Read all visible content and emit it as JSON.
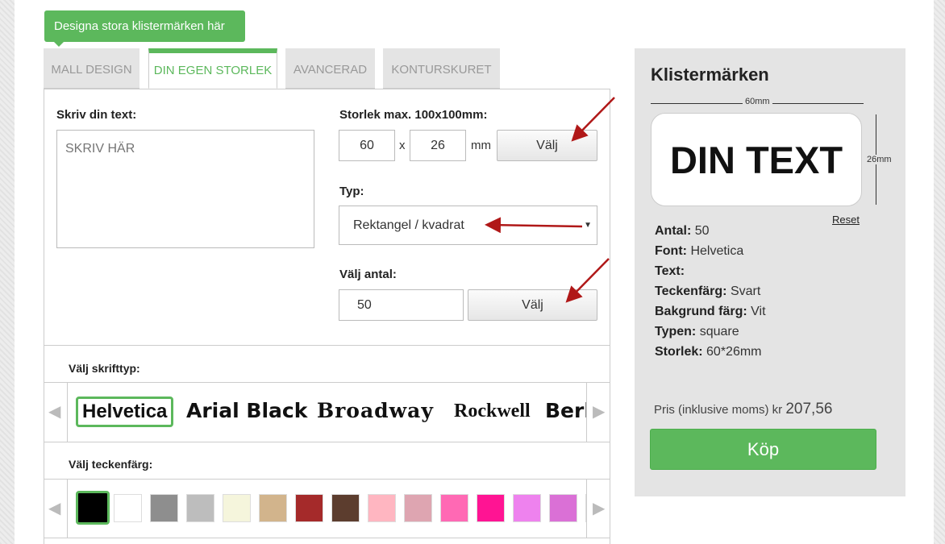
{
  "banner": "Designa stora klistermärken här",
  "tabs": [
    {
      "label": "MALL DESIGN",
      "active": false
    },
    {
      "label": "DIN EGEN STORLEK",
      "active": true
    },
    {
      "label": "AVANCERAD",
      "active": false
    },
    {
      "label": "KONTURSKURET",
      "active": false
    }
  ],
  "text_section": {
    "label": "Skriv din text:",
    "placeholder": "SKRIV HÄR"
  },
  "size_section": {
    "label": "Storlek max. 100x100mm:",
    "width": "60",
    "separator": "x",
    "height": "26",
    "unit": "mm",
    "button": "Välj"
  },
  "type_section": {
    "label": "Typ:",
    "selected": "Rektangel / kvadrat"
  },
  "quantity_section": {
    "label": "Välj antal:",
    "value": "50",
    "button": "Välj"
  },
  "font_section": {
    "label": "Välj skrifttyp:",
    "fonts": [
      "Helvetica",
      "Arial Black",
      "Broadway",
      "Rockwell",
      "Berl"
    ]
  },
  "color_section": {
    "label": "Välj teckenfärg:",
    "colors": [
      "#000000",
      "#ffffff",
      "#8e8e8e",
      "#bdbdbd",
      "#f5f5dc",
      "#d2b48c",
      "#a52a2a",
      "#5c3d2e",
      "#ffb6c1",
      "#dea5b1",
      "#ff69b4",
      "#ff1493",
      "#ee82ee",
      "#da70d6",
      "#cc00cc"
    ]
  },
  "summary": {
    "title": "Klistermärken",
    "width_label": "60mm",
    "height_label": "26mm",
    "preview_text": "DIN TEXT",
    "reset": "Reset",
    "specs": [
      {
        "key": "Antal:",
        "value": "50"
      },
      {
        "key": "Font:",
        "value": "Helvetica"
      },
      {
        "key": "Text:",
        "value": ""
      },
      {
        "key": "Teckenfärg:",
        "value": "Svart"
      },
      {
        "key": "Bakgrund färg:",
        "value": "Vit"
      },
      {
        "key": "Typen:",
        "value": "square"
      },
      {
        "key": "Storlek:",
        "value": "60*26mm"
      }
    ],
    "price_label": "Pris (inklusive moms) kr",
    "price_value": "207,56",
    "buy_button": "Köp"
  },
  "colors": {
    "accent": "#5cb85c",
    "annotation_arrow": "#b01818"
  }
}
